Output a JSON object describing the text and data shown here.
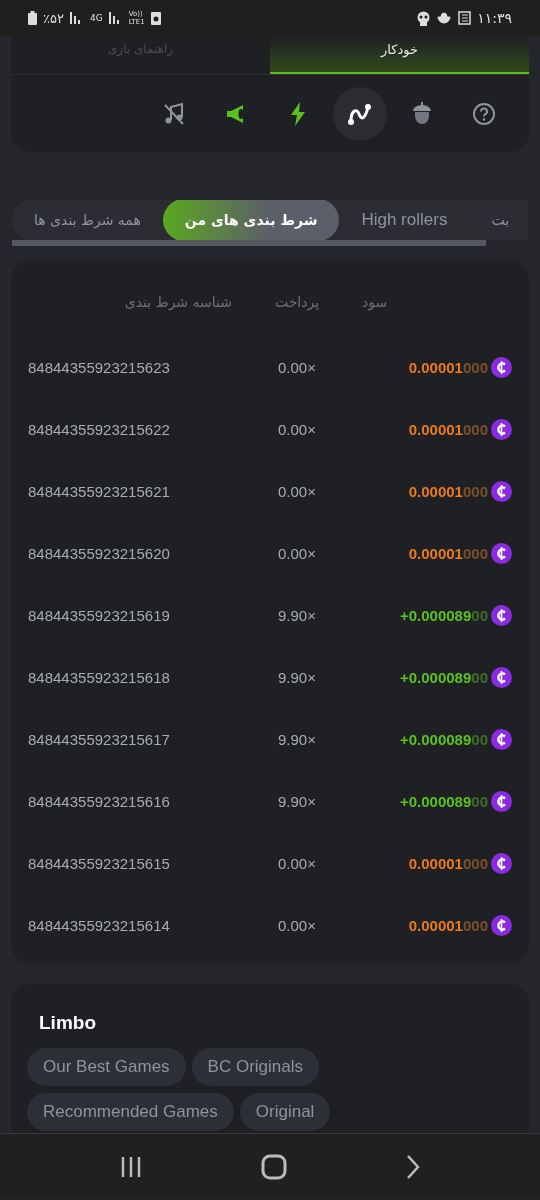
{
  "status_bar": {
    "battery": "٪۵۲",
    "network": "4G",
    "volte_top": "Vo))",
    "volte_bottom": "LTE1",
    "time": "۱۱:۳۹"
  },
  "mode_tabs": [
    {
      "label": "خودکار",
      "selected": true
    },
    {
      "label": "راهنمای بازی",
      "selected": false
    }
  ],
  "toolbar": [
    {
      "kind": "help",
      "on": false,
      "selected": false
    },
    {
      "kind": "acorn",
      "on": false,
      "selected": false
    },
    {
      "kind": "curve",
      "on": false,
      "selected": true
    },
    {
      "kind": "bolt",
      "on": true,
      "selected": false
    },
    {
      "kind": "horn",
      "on": true,
      "selected": false
    },
    {
      "kind": "music-off",
      "on": false,
      "selected": false
    }
  ],
  "bet_tabs": [
    {
      "label": "بت",
      "selected": false
    },
    {
      "label": "High rollers",
      "selected": false
    },
    {
      "label": "شرط بندی های من",
      "selected": true
    },
    {
      "label": "همه شرط بندی ها",
      "selected": false
    }
  ],
  "table": {
    "columns": [
      "سود",
      "پرداخت",
      "شناسه شرط بندی"
    ],
    "rows": [
      {
        "kind": "loss",
        "profit_main": "0.00001",
        "profit_trailing": "000",
        "payout": "0.00×",
        "id": "84844355923215623"
      },
      {
        "kind": "loss",
        "profit_main": "0.00001",
        "profit_trailing": "000",
        "payout": "0.00×",
        "id": "84844355923215622"
      },
      {
        "kind": "loss",
        "profit_main": "0.00001",
        "profit_trailing": "000",
        "payout": "0.00×",
        "id": "84844355923215621"
      },
      {
        "kind": "loss",
        "profit_main": "0.00001",
        "profit_trailing": "000",
        "payout": "0.00×",
        "id": "84844355923215620"
      },
      {
        "kind": "win",
        "profit_main": "+0.000089",
        "profit_trailing": "00",
        "payout": "9.90×",
        "id": "84844355923215619"
      },
      {
        "kind": "win",
        "profit_main": "+0.000089",
        "profit_trailing": "00",
        "payout": "9.90×",
        "id": "84844355923215618"
      },
      {
        "kind": "win",
        "profit_main": "+0.000089",
        "profit_trailing": "00",
        "payout": "9.90×",
        "id": "84844355923215617"
      },
      {
        "kind": "win",
        "profit_main": "+0.000089",
        "profit_trailing": "00",
        "payout": "9.90×",
        "id": "84844355923215616"
      },
      {
        "kind": "loss",
        "profit_main": "0.00001",
        "profit_trailing": "000",
        "payout": "0.00×",
        "id": "84844355923215615"
      },
      {
        "kind": "loss",
        "profit_main": "0.00001",
        "profit_trailing": "000",
        "payout": "0.00×",
        "id": "84844355923215614"
      }
    ]
  },
  "game": {
    "title": "Limbo",
    "tags": [
      "Our Best Games",
      "BC Originals",
      "Recommended Games",
      "Original"
    ]
  }
}
